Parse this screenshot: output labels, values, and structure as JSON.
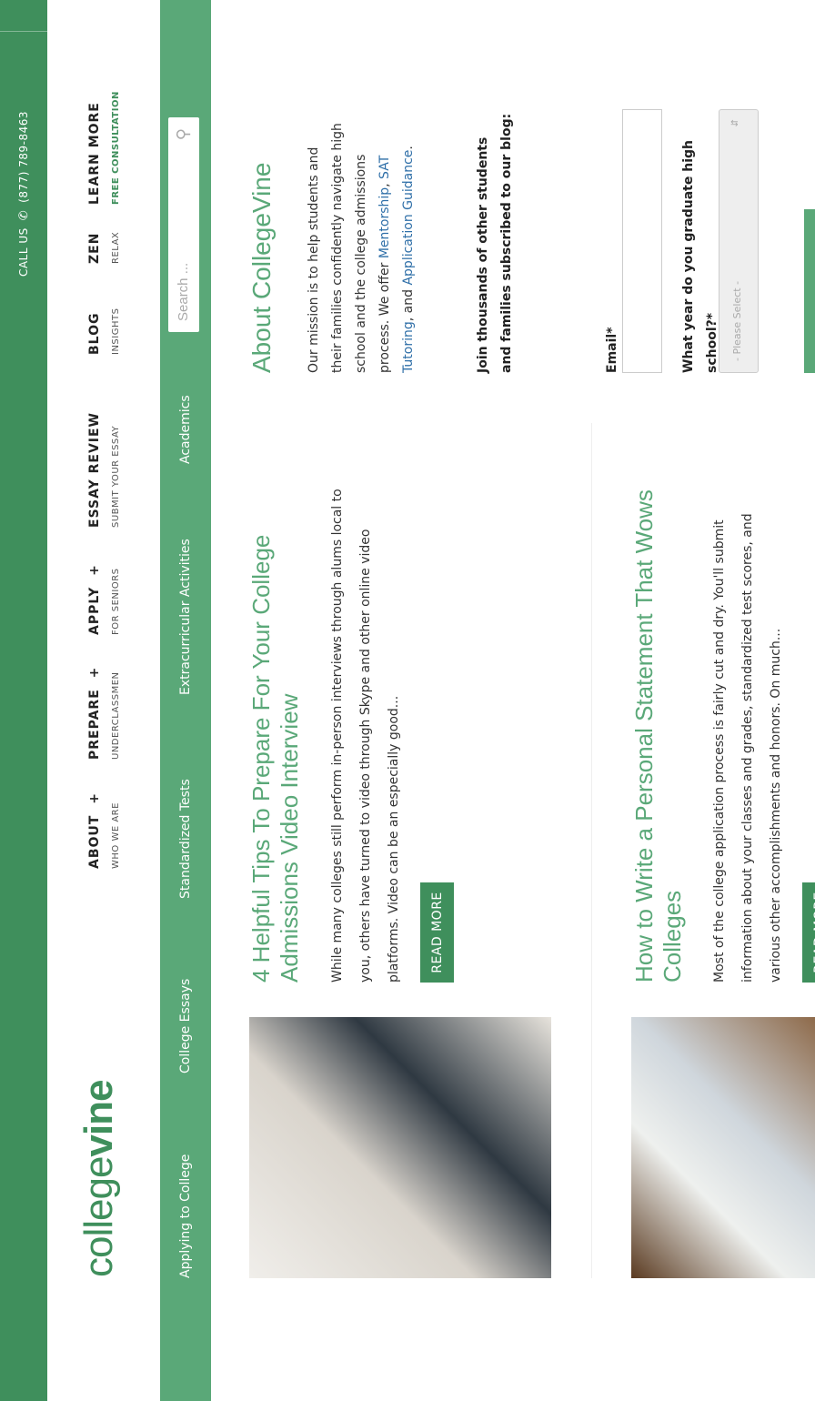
{
  "topbar": {
    "call_label": "CALL US",
    "phone_icon": "phone-icon",
    "phone": "(877) 789-8463"
  },
  "logo": {
    "part1": "college",
    "part2": "vine"
  },
  "nav": [
    {
      "title": "ABOUT",
      "sub": "WHO WE ARE",
      "plus": true
    },
    {
      "title": "PREPARE",
      "sub": "UNDERCLASSMEN",
      "plus": true
    },
    {
      "title": "APPLY",
      "sub": "FOR SENIORS",
      "plus": true
    },
    {
      "title": "ESSAY REVIEW",
      "sub": "SUBMIT YOUR ESSAY"
    },
    {
      "title": "BLOG",
      "sub": "INSIGHTS"
    },
    {
      "title": "ZEN",
      "sub": "RELAX"
    },
    {
      "title": "LEARN MORE",
      "sub": "FREE CONSULTATION"
    }
  ],
  "categories": [
    "Applying to College",
    "College Essays",
    "Standardized Tests",
    "Extracurricular Activities",
    "Academics"
  ],
  "search": {
    "placeholder": "Search ...",
    "icon": "search-icon"
  },
  "posts": [
    {
      "title": "4 Helpful Tips To Prepare For Your College Admissions Video Interview",
      "excerpt": "While many colleges still perform in-person interviews through alums local to you, others have turned to video through Skype and other online video platforms. Video can be an especially good...",
      "read_more": "READ MORE"
    },
    {
      "title": "How to Write a Personal Statement That Wows Colleges",
      "excerpt": "Most of the college application process is fairly cut and dry. You'll submit information about your classes and grades, standardized test scores, and various other accomplishments and honors. On much...",
      "read_more": "READ MORE"
    }
  ],
  "sidebar": {
    "heading": "About CollegeVine",
    "mission_text": "Our mission is to help students and their families confidently navigate high school and the college admissions process. We offer",
    "links": [
      "Mentorship",
      "SAT Tutoring",
      "Application Guidance"
    ],
    "connector_comma": ",",
    "connector_and": ", and",
    "period": ".",
    "join_text": "Join thousands of other students and families subscribed to our blog:",
    "email_label": "Email*",
    "year_label": "What year do you graduate high school?*",
    "select_placeholder": "- Please Select -"
  },
  "colors": {
    "primary": "#3f8f5c",
    "accent": "#5aa878",
    "link": "#2f6fa8"
  }
}
